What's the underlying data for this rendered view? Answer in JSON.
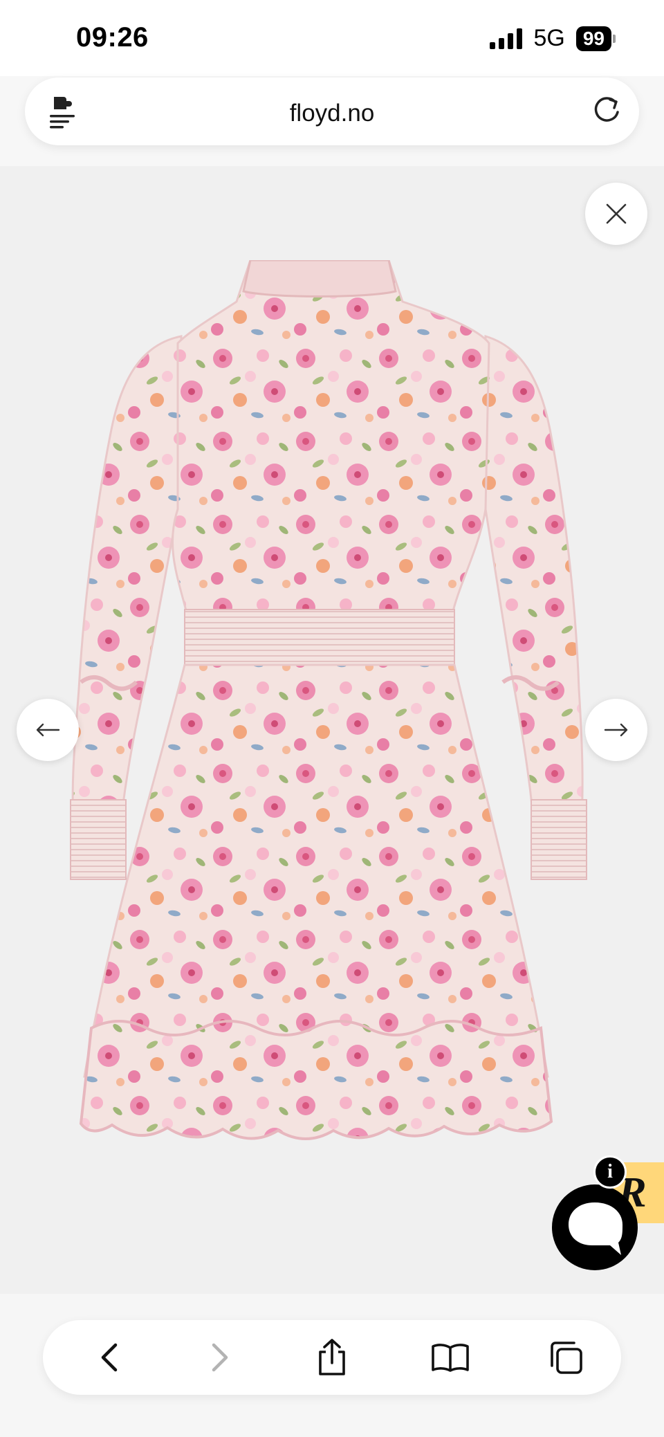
{
  "status_bar": {
    "time": "09:26",
    "network": "5G",
    "battery": "99"
  },
  "browser": {
    "url": "floyd.no",
    "extension_icon": "extension-menu-icon",
    "reload_icon": "reload-icon"
  },
  "viewer": {
    "background": "#f0f0f0",
    "close_icon": "close-icon",
    "prev_icon": "arrow-left-icon",
    "next_icon": "arrow-right-icon",
    "product_image": "floral-dress-back-view"
  },
  "chat_widget": {
    "badge_letter": "R",
    "info_letter": "i",
    "badge_color": "#ffd77a"
  },
  "toolbar": {
    "back_icon": "chevron-left-icon",
    "forward_icon": "chevron-right-icon",
    "share_icon": "share-icon",
    "bookmarks_icon": "book-icon",
    "tabs_icon": "tabs-icon"
  }
}
